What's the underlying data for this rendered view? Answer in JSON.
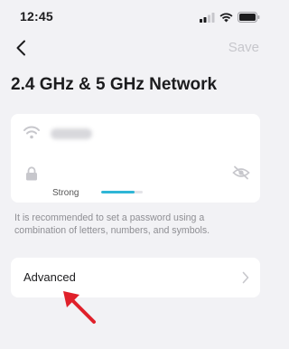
{
  "status_bar": {
    "time": "12:45"
  },
  "nav": {
    "save_label": "Save"
  },
  "page": {
    "title": "2.4 GHz & 5 GHz Network"
  },
  "credentials": {
    "password_strength_label": "Strong",
    "password_strength_level": 0.8
  },
  "hint_text": "It is recommended to set a password using a combination of letters, numbers, and symbols.",
  "advanced": {
    "label": "Advanced"
  },
  "colors": {
    "accent": "#2fb6d6",
    "annotation_arrow": "#e0202a"
  }
}
